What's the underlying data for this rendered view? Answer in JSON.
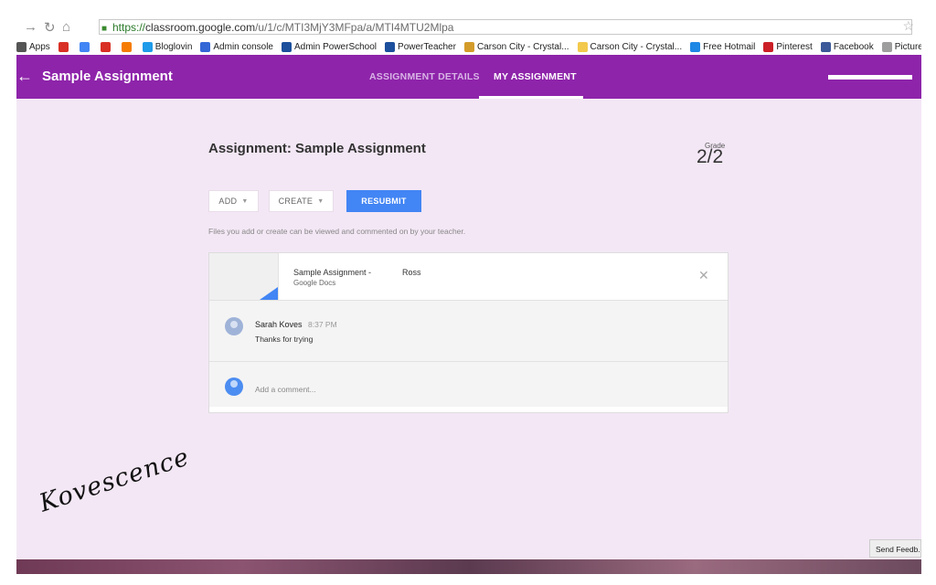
{
  "browser": {
    "url_scheme": "https://",
    "url_host": "classroom.google.com",
    "url_path": "/u/1/c/MTI3MjY3MFpa/a/MTI4MTU2Mlpa",
    "bookmarks": [
      {
        "label": "Apps",
        "icon": "apps-icon",
        "color": "#555555"
      },
      {
        "label": "",
        "icon": "gmail-icon",
        "color": "#d93025"
      },
      {
        "label": "",
        "icon": "google-plus-icon",
        "color": "#4285f4"
      },
      {
        "label": "",
        "icon": "gmail-icon",
        "color": "#d93025"
      },
      {
        "label": "",
        "icon": "blogger-icon",
        "color": "#f57c00"
      },
      {
        "label": "Bloglovin",
        "icon": "bloglovin-icon",
        "color": "#1e9be9"
      },
      {
        "label": "Admin console",
        "icon": "admin-console-icon",
        "color": "#3367d6"
      },
      {
        "label": "Admin PowerSchool",
        "icon": "powerschool-icon",
        "color": "#1c4f9c"
      },
      {
        "label": "PowerTeacher",
        "icon": "powerschool-icon",
        "color": "#1c4f9c"
      },
      {
        "label": "Carson City - Crystal...",
        "icon": "crystal-icon",
        "color": "#d39c2a"
      },
      {
        "label": "Carson City - Crystal...",
        "icon": "crystal-icon",
        "color": "#f2c94c"
      },
      {
        "label": "Free Hotmail",
        "icon": "windows-icon",
        "color": "#1e88e5"
      },
      {
        "label": "Pinterest",
        "icon": "pinterest-icon",
        "color": "#cb2027"
      },
      {
        "label": "Facebook",
        "icon": "facebook-icon",
        "color": "#3b5998"
      },
      {
        "label": "Picture Writing Pro...",
        "icon": "document-icon",
        "color": "#9e9e9e"
      }
    ]
  },
  "appbar": {
    "title": "Sample Assignment",
    "tabs": [
      {
        "label": "ASSIGNMENT DETAILS",
        "active": false
      },
      {
        "label": "MY ASSIGNMENT",
        "active": true
      }
    ],
    "color": "#8e24aa"
  },
  "assignment": {
    "heading": "Assignment: Sample Assignment",
    "grade_label": "Grade",
    "grade_value": "2/2",
    "buttons": {
      "add": "ADD",
      "create": "CREATE",
      "resubmit": "RESUBMIT"
    },
    "help_text": "Files you add or create can be viewed and commented on by your teacher.",
    "file": {
      "name": "Sample Assignment -",
      "owner": "Ross",
      "type": "Google Docs"
    },
    "comments": [
      {
        "author": "Sarah Koves",
        "time": "8:37 PM",
        "text": "Thanks for trying"
      }
    ],
    "add_comment_placeholder": "Add a comment..."
  },
  "watermark": "Kovescence",
  "feedback_button": "Send Feedb..."
}
